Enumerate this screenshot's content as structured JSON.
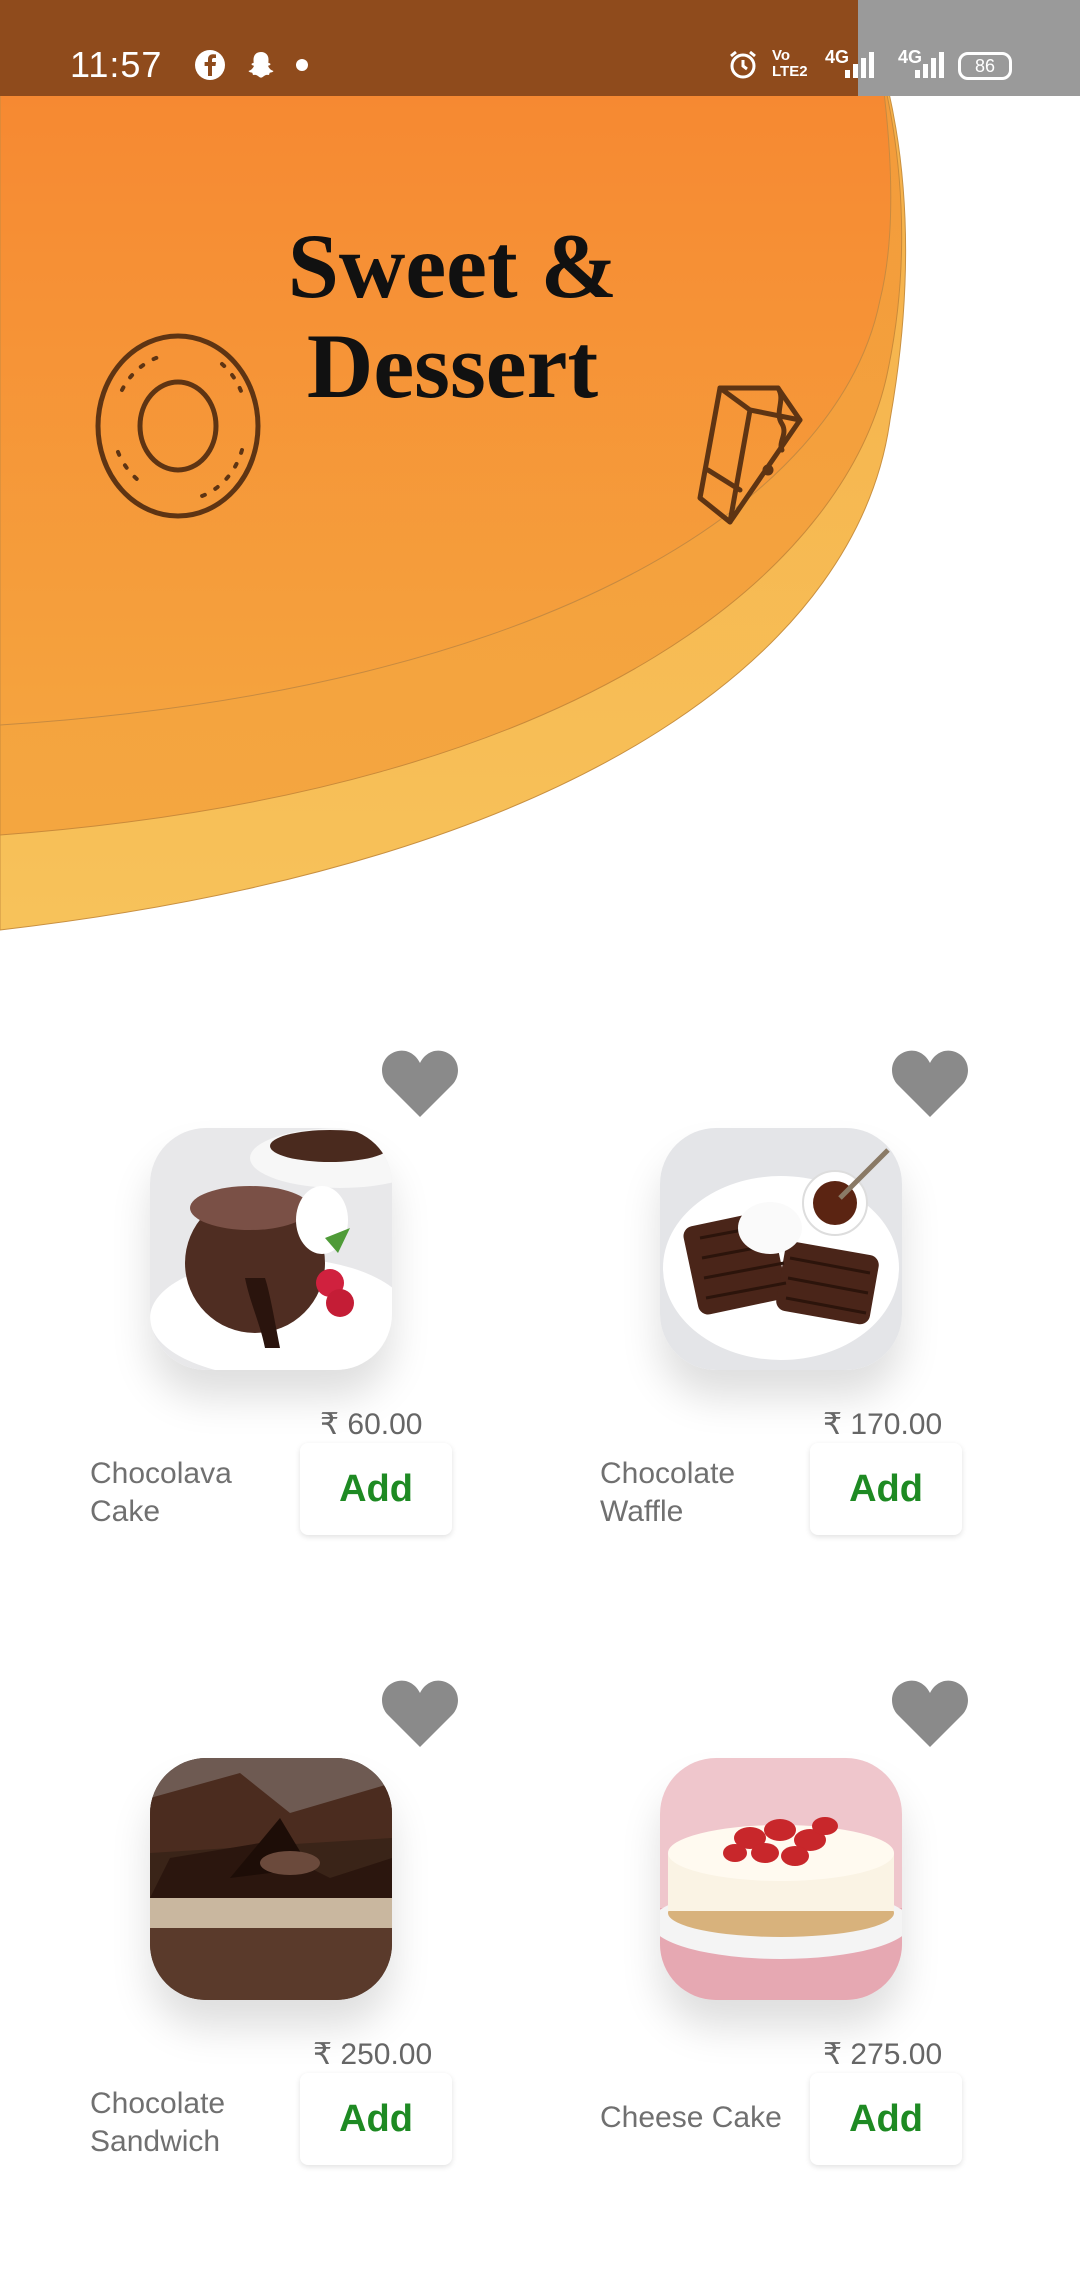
{
  "status_bar": {
    "time": "11:57",
    "battery": "86",
    "net1": "4G",
    "net2": "4G",
    "volte": "VoLTE2"
  },
  "header": {
    "title_line1": "Sweet &",
    "title_line2": "Dessert"
  },
  "colors": {
    "status": "#8f4b1c",
    "wave_top": "#f58a30",
    "wave_bottom": "#f7c059",
    "accent_green": "#1e8a23",
    "heart": "#8a8a8a"
  },
  "products": [
    {
      "name": "Chocolava Cake",
      "price": "₹ 60.00",
      "add_label": "Add",
      "favorite_icon": "heart-icon"
    },
    {
      "name": "Chocolate Waffle",
      "price": "₹ 170.00",
      "add_label": "Add",
      "favorite_icon": "heart-icon"
    },
    {
      "name": "Chocolate Sandwich",
      "price": "₹ 250.00",
      "add_label": "Add",
      "favorite_icon": "heart-icon"
    },
    {
      "name": "Cheese Cake",
      "price": "₹ 275.00",
      "add_label": "Add",
      "favorite_icon": "heart-icon"
    }
  ]
}
